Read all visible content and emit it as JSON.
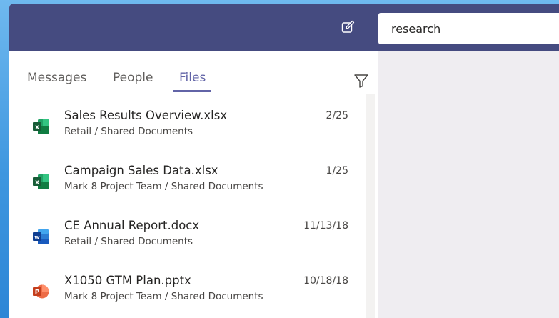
{
  "search": {
    "value": "research"
  },
  "tabs": [
    {
      "label": "Messages",
      "active": false
    },
    {
      "label": "People",
      "active": false
    },
    {
      "label": "Files",
      "active": true
    }
  ],
  "files": [
    {
      "name": "Sales Results Overview.xlsx",
      "path": "Retail / Shared Documents",
      "date": "2/25",
      "type": "excel",
      "icon": "excel-icon"
    },
    {
      "name": "Campaign Sales Data.xlsx",
      "path": "Mark 8 Project Team / Shared Documents",
      "date": "1/25",
      "type": "excel",
      "icon": "excel-icon"
    },
    {
      "name": "CE Annual Report.docx",
      "path": "Retail / Shared Documents",
      "date": "11/13/18",
      "type": "word",
      "icon": "word-icon"
    },
    {
      "name": "X1050 GTM Plan.pptx",
      "path": "Mark 8 Project Team / Shared Documents",
      "date": "10/18/18",
      "type": "powerpoint",
      "icon": "powerpoint-icon"
    }
  ],
  "colors": {
    "header": "#454b80",
    "accent": "#6264a7",
    "excel": "#1d7244",
    "word": "#2b5797",
    "powerpoint": "#d24726"
  }
}
